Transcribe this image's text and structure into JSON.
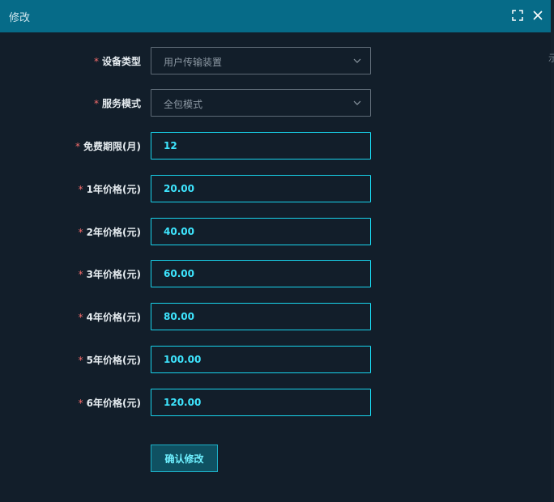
{
  "dialog": {
    "title": "修改",
    "maximize_icon": "fullscreen-icon",
    "close_icon": "close-icon"
  },
  "edge_text": "示",
  "form": {
    "required_mark": "*",
    "device_type": {
      "label": "设备类型",
      "value": "用户传输装置"
    },
    "service_mode": {
      "label": "服务模式",
      "value": "全包模式"
    },
    "free_period": {
      "label": "免费期限(月)",
      "value": "12"
    },
    "price_year_1": {
      "label": "1年价格(元)",
      "value": "20.00"
    },
    "price_year_2": {
      "label": "2年价格(元)",
      "value": "40.00"
    },
    "price_year_3": {
      "label": "3年价格(元)",
      "value": "60.00"
    },
    "price_year_4": {
      "label": "4年价格(元)",
      "value": "80.00"
    },
    "price_year_5": {
      "label": "5年价格(元)",
      "value": "100.00"
    },
    "price_year_6": {
      "label": "6年价格(元)",
      "value": "120.00"
    },
    "submit_label": "确认修改"
  },
  "colors": {
    "title_bar": "#066b88",
    "background": "#121e2a",
    "accent": "#18d4ec",
    "required": "#f56c6c"
  }
}
